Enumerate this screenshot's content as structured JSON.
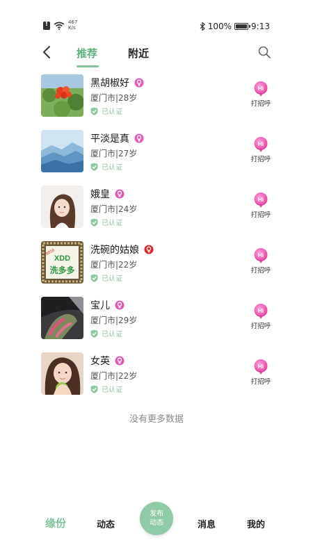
{
  "status_bar": {
    "net_speed_value": "467",
    "net_speed_unit": "K/s",
    "battery": "100%",
    "time": "9:13"
  },
  "header": {
    "tabs": [
      {
        "label": "推荐",
        "active": true
      },
      {
        "label": "附近",
        "active": false
      }
    ]
  },
  "users": [
    {
      "name": "黑胡椒好",
      "meta": "厦门市|28岁",
      "verified": "已认证",
      "greet": "打招呼",
      "gender_color": "#e05bb5"
    },
    {
      "name": "平淡是真",
      "meta": "厦门市|27岁",
      "verified": "已认证",
      "greet": "打招呼",
      "gender_color": "#e05bb5"
    },
    {
      "name": "娥皇",
      "meta": "厦门市|24岁",
      "verified": "已认证",
      "greet": "打招呼",
      "gender_color": "#e05bb5"
    },
    {
      "name": "洗碗的姑娘",
      "meta": "厦门市|22岁",
      "verified": "已认证",
      "greet": "打招呼",
      "gender_color": "#d9282b"
    },
    {
      "name": "宝儿",
      "meta": "厦门市|29岁",
      "verified": "已认证",
      "greet": "打招呼",
      "gender_color": "#e05bb5"
    },
    {
      "name": "女英",
      "meta": "厦门市|22岁",
      "verified": "已认证",
      "greet": "打招呼",
      "gender_color": "#e05bb5"
    }
  ],
  "avatar4_text": {
    "top": "XDD",
    "bottom": "洗多多",
    "corner": "8816"
  },
  "no_more_text": "没有更多数据",
  "bottom_nav": {
    "yuanfen": "缘份",
    "dongtai": "动态",
    "publish_line1": "发布",
    "publish_line2": "动态",
    "xiaoxi": "消息",
    "wode": "我的"
  },
  "colors": {
    "accent": "#7fc49a",
    "verified": "#8fc79f",
    "hi_pink": "#e84fa8"
  }
}
